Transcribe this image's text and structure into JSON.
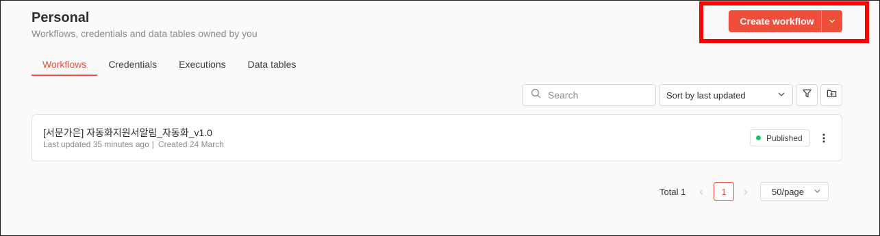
{
  "header": {
    "title": "Personal",
    "subtitle": "Workflows, credentials and data tables owned by you",
    "create_button_label": "Create workflow",
    "accent_color": "#ef4f3a"
  },
  "tabs": [
    {
      "label": "Workflows",
      "active": true
    },
    {
      "label": "Credentials",
      "active": false
    },
    {
      "label": "Executions",
      "active": false
    },
    {
      "label": "Data tables",
      "active": false
    }
  ],
  "toolbar": {
    "search_placeholder": "Search",
    "sort_value": "Sort by last updated",
    "filter_icon": "filter-icon",
    "folder_icon": "new-folder-icon"
  },
  "workflows": [
    {
      "name": "[서문가은] 자동화지원서알림_자동화_v1.0",
      "last_updated": "Last updated 35 minutes ago",
      "created": "Created 24 March",
      "status": "Published",
      "status_color": "#1fc26b"
    }
  ],
  "pagination": {
    "total": "Total 1",
    "current_page": "1",
    "page_size": "50/page"
  }
}
